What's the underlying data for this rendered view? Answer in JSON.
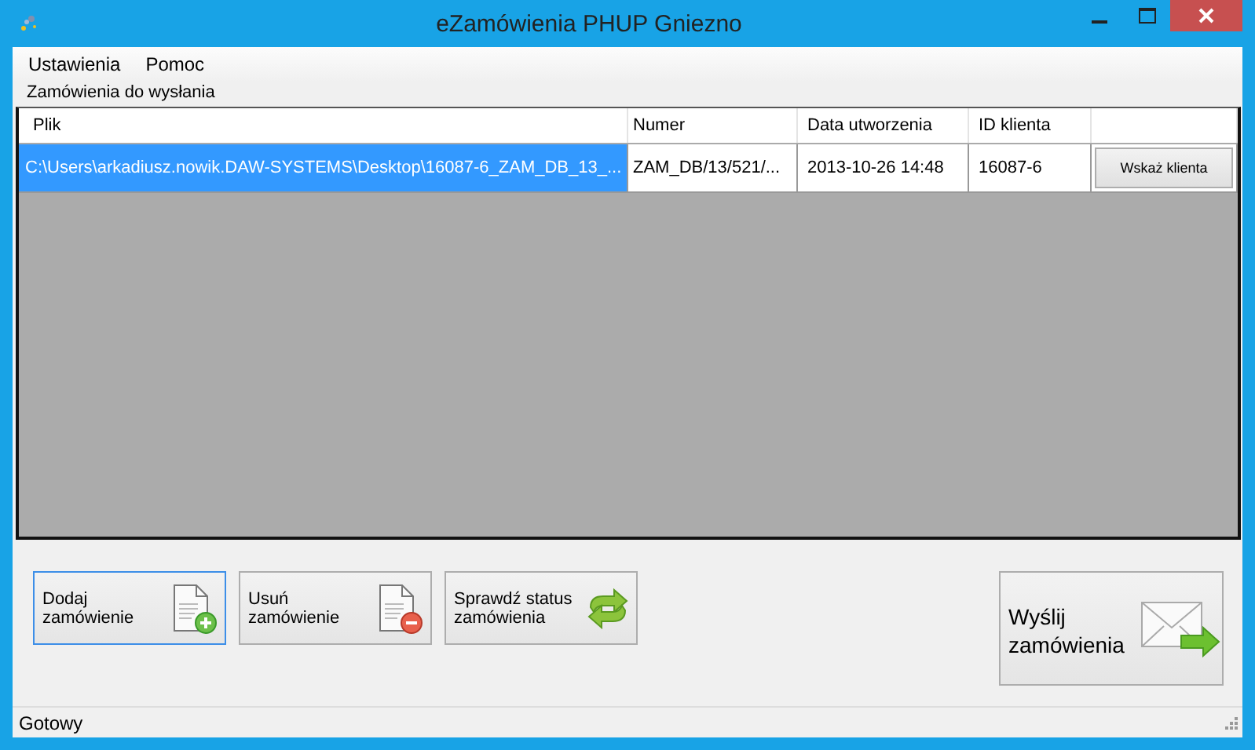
{
  "window": {
    "title": "eZamówienia PHUP Gniezno"
  },
  "menu": [
    "Ustawienia",
    "Pomoc"
  ],
  "group": {
    "label": "Zamówienia do wysłania"
  },
  "table": {
    "columns": [
      "Plik",
      "Numer",
      "Data utworzenia",
      "ID klienta"
    ],
    "rows": [
      {
        "selected": true,
        "cells": [
          "C:\\Users\\arkadiusz.nowik.DAW-SYSTEMS\\Desktop\\16087-6_ZAM_DB_13_...",
          "ZAM_DB/13/521/...",
          "2013-10-26 14:48",
          "16087-6"
        ],
        "action": "Wskaż klienta"
      }
    ]
  },
  "buttons": [
    {
      "label": "Dodaj\nzamówienie",
      "kind": "add",
      "selected": true
    },
    {
      "label": "Usuń\nzamówienie",
      "kind": "remove",
      "selected": false
    },
    {
      "label": "Sprawdź status\nzamówienia",
      "kind": "refresh",
      "selected": false
    }
  ],
  "send_button": {
    "label": "Wyślij\nzamówienia"
  },
  "status_bar": "Gotowy"
}
